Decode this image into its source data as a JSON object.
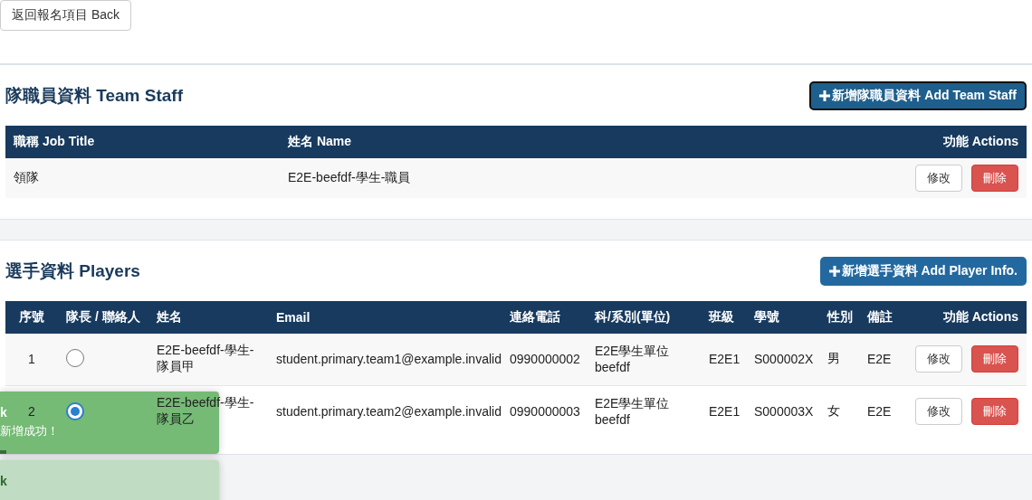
{
  "back_button": "返回報名項目 Back",
  "staff": {
    "title": "隊職員資料 Team Staff",
    "add_button": "新增隊職員資料 Add Team Staff",
    "columns": [
      "職稱 Job Title",
      "姓名 Name",
      "功能 Actions"
    ],
    "rows": [
      {
        "job_title": "領隊",
        "name": "E2E-beefdf-學生-職員",
        "actions": [
          {
            "kind": "edit",
            "label": "修改"
          },
          {
            "kind": "delete",
            "label": "刪除"
          }
        ]
      }
    ]
  },
  "players": {
    "title": "選手資料 Players",
    "add_button": "新增選手資料 Add Player Info.",
    "columns": [
      "序號",
      "隊長 / 聯絡人",
      "姓名",
      "Email",
      "連絡電話",
      "科/系別(單位)",
      "班級",
      "學號",
      "性別",
      "備註",
      "功能 Actions"
    ],
    "rows": [
      {
        "number": "1",
        "selected": false,
        "name": "E2E-beefdf-學生-隊員甲",
        "email": "student.primary.team1@example.invalid",
        "phone": "0990000002",
        "department": "E2E學生單位 beefdf",
        "class": "E2E1",
        "student_id": "S000002X",
        "gender": "男",
        "note": "E2E",
        "actions": [
          {
            "kind": "edit",
            "label": "修改"
          },
          {
            "kind": "delete",
            "label": "刪除"
          }
        ]
      },
      {
        "number": "2",
        "selected": true,
        "name": "E2E-beefdf-學生-隊員乙",
        "email": "student.primary.team2@example.invalid",
        "phone": "0990000003",
        "department": "E2E學生單位 beefdf",
        "class": "E2E1",
        "student_id": "S000003X",
        "gender": "女",
        "note": "E2E",
        "actions": [
          {
            "kind": "edit",
            "label": "修改"
          },
          {
            "kind": "delete",
            "label": "刪除"
          }
        ]
      }
    ]
  },
  "toasts": [
    {
      "kind": "success",
      "title": "k",
      "message": "新增成功！",
      "level": 0.03
    },
    {
      "kind": "fading",
      "title": "k"
    }
  ]
}
